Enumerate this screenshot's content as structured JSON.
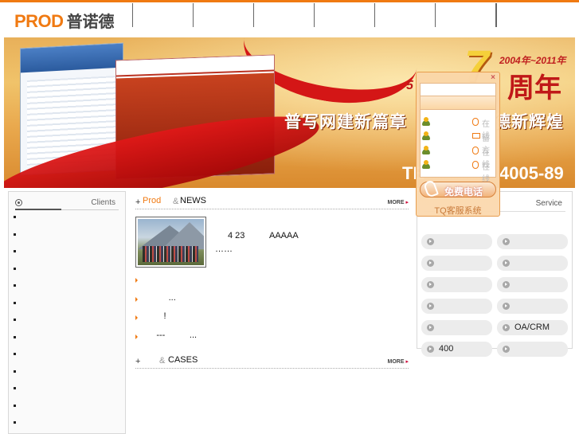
{
  "header": {
    "logo_en": "PROD",
    "logo_cn": "普诺德",
    "nav_items": [
      "",
      "",
      "",
      "",
      "",
      ""
    ]
  },
  "banner": {
    "years": "2004年~2011年",
    "big_number": "7",
    "anniversary": "周年",
    "five": "5",
    "slogan_left": "普写网建新篇章",
    "slogan_right": "德新辉煌",
    "tel_prefix": "TE",
    "tel_suffix": "4005-89"
  },
  "left_panel": {
    "title": "Clients",
    "items": [
      "",
      "",
      "",
      "",
      "",
      "",
      "",
      "",
      "",
      "",
      "",
      "",
      ""
    ]
  },
  "news": {
    "plus": "+",
    "title_cn": "Prod",
    "amp": "&",
    "title_en": "NEWS",
    "more": "MORE",
    "featured_date": "4 23",
    "featured_name": "AAAAA",
    "featured_ellipsis": "……",
    "list": [
      {
        "text": ""
      },
      {
        "text": "           ..."
      },
      {
        "text": "         !"
      },
      {
        "text": "      ---          ..."
      }
    ]
  },
  "cases": {
    "plus": "+",
    "amp": "&",
    "title_en": "CASES",
    "more": "MORE"
  },
  "service": {
    "title": "Service",
    "items": [
      {
        "label": ""
      },
      {
        "label": ""
      },
      {
        "label": ""
      },
      {
        "label": ""
      },
      {
        "label": ""
      },
      {
        "label": ""
      },
      {
        "label": ""
      },
      {
        "label": ""
      },
      {
        "label": ""
      },
      {
        "label": "OA/CRM"
      },
      {
        "label": "400"
      },
      {
        "label": ""
      }
    ]
  },
  "chat_widget": {
    "close": "×",
    "rows": [
      {
        "status": "在线",
        "icon": "online-icon"
      },
      {
        "status": "留言",
        "icon": "mail-icon"
      },
      {
        "status": "在线",
        "icon": "online-icon"
      },
      {
        "status": "在线",
        "icon": "online-icon"
      }
    ],
    "call_label": "免费电话",
    "brand": "TQ客服系统"
  },
  "colors": {
    "accent": "#f07a12",
    "banner_red": "#c01818",
    "service_pill": "#ececec"
  }
}
